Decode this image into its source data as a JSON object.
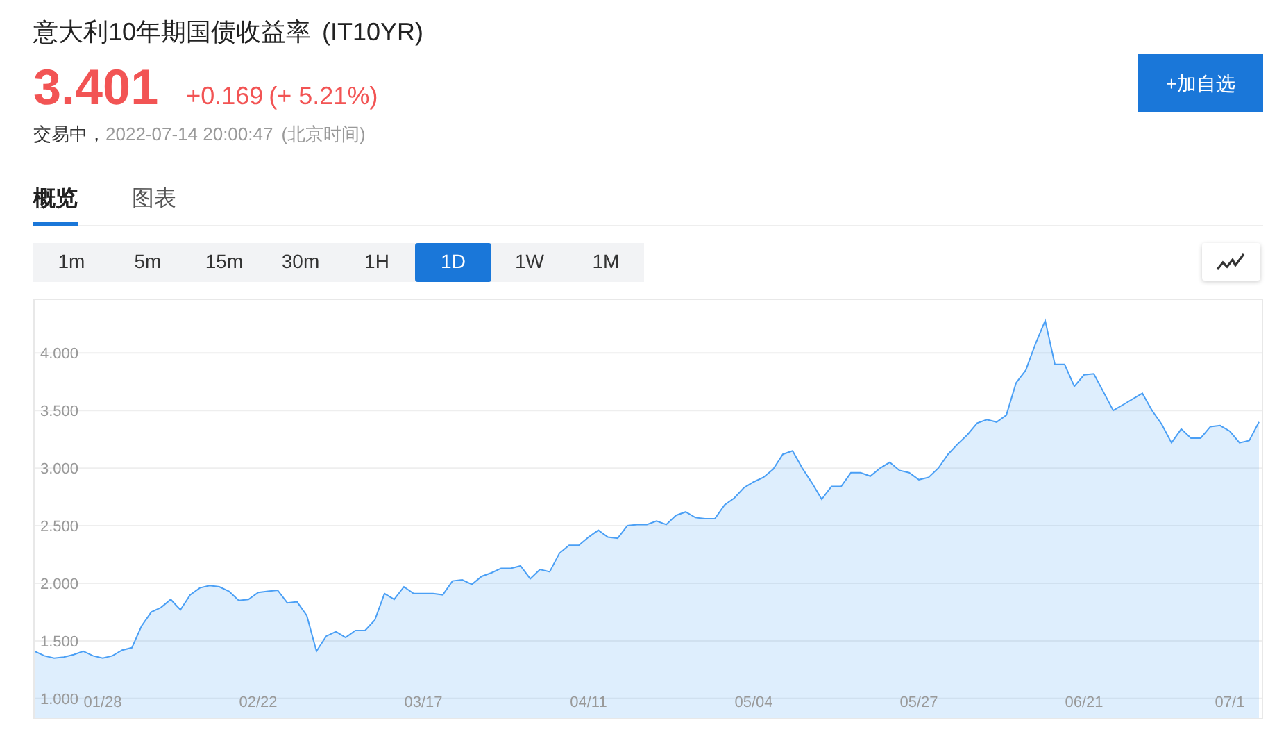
{
  "header": {
    "title": "意大利10年期国债收益率",
    "symbol": "(IT10YR)",
    "price": "3.401",
    "change": "+0.169",
    "change_pct": "(+ 5.21%)",
    "status": "交易中，",
    "timestamp": "2022-07-14 20:00:47",
    "timezone": "(北京时间)",
    "add_button": "+加自选"
  },
  "tabs": [
    {
      "label": "概览",
      "selected": true
    },
    {
      "label": "图表",
      "selected": false
    }
  ],
  "intervals": [
    {
      "label": "1m",
      "selected": false
    },
    {
      "label": "5m",
      "selected": false
    },
    {
      "label": "15m",
      "selected": false
    },
    {
      "label": "30m",
      "selected": false
    },
    {
      "label": "1H",
      "selected": false
    },
    {
      "label": "1D",
      "selected": true
    },
    {
      "label": "1W",
      "selected": false
    },
    {
      "label": "1M",
      "selected": false
    }
  ],
  "chart": {
    "chart_data": {
      "type": "area",
      "grid": true,
      "categories": [
        null,
        null,
        null,
        null,
        null,
        null,
        null,
        "01/28",
        null,
        null,
        null,
        null,
        null,
        null,
        null,
        null,
        null,
        null,
        null,
        null,
        null,
        null,
        null,
        "02/22",
        null,
        null,
        null,
        null,
        null,
        null,
        null,
        null,
        null,
        null,
        null,
        null,
        null,
        null,
        null,
        null,
        "03/17",
        null,
        null,
        null,
        null,
        null,
        null,
        null,
        null,
        null,
        null,
        null,
        null,
        null,
        null,
        null,
        null,
        "04/11",
        null,
        null,
        null,
        null,
        null,
        null,
        null,
        null,
        null,
        null,
        null,
        null,
        null,
        null,
        null,
        null,
        "05/04",
        null,
        null,
        null,
        null,
        null,
        null,
        null,
        null,
        null,
        null,
        null,
        null,
        null,
        null,
        null,
        null,
        "05/27",
        null,
        null,
        null,
        null,
        null,
        null,
        null,
        null,
        null,
        null,
        null,
        null,
        null,
        null,
        null,
        null,
        "06/21",
        null,
        null,
        null,
        null,
        null,
        null,
        null,
        null,
        null,
        null,
        null,
        null,
        null,
        null,
        "07/1",
        null,
        null,
        null
      ],
      "series": [
        {
          "color": "#4a9ff5",
          "values": [
            1.41,
            1.37,
            1.35,
            1.36,
            1.38,
            1.41,
            1.37,
            1.35,
            1.37,
            1.42,
            1.44,
            1.63,
            1.75,
            1.79,
            1.86,
            1.77,
            1.9,
            1.96,
            1.98,
            1.97,
            1.93,
            1.85,
            1.86,
            1.92,
            1.93,
            1.94,
            1.83,
            1.84,
            1.72,
            1.41,
            1.54,
            1.58,
            1.53,
            1.59,
            1.59,
            1.68,
            1.91,
            1.86,
            1.97,
            1.91,
            1.91,
            1.91,
            1.9,
            2.02,
            2.03,
            1.99,
            2.06,
            2.09,
            2.13,
            2.13,
            2.15,
            2.04,
            2.12,
            2.1,
            2.26,
            2.33,
            2.33,
            2.4,
            2.46,
            2.4,
            2.39,
            2.5,
            2.51,
            2.51,
            2.54,
            2.51,
            2.59,
            2.62,
            2.57,
            2.56,
            2.56,
            2.68,
            2.74,
            2.83,
            2.88,
            2.92,
            2.99,
            3.12,
            3.15,
            3,
            2.87,
            2.73,
            2.84,
            2.84,
            2.96,
            2.96,
            2.93,
            3,
            3.05,
            2.98,
            2.96,
            2.9,
            2.92,
            3,
            3.12,
            3.21,
            3.29,
            3.39,
            3.42,
            3.4,
            3.46,
            3.74,
            3.85,
            4.08,
            4.28,
            3.9,
            3.9,
            3.71,
            3.81,
            3.82,
            3.66,
            3.5,
            3.55,
            3.6,
            3.65,
            3.5,
            3.38,
            3.22,
            3.34,
            3.26,
            3.26,
            3.36,
            3.37,
            3.32,
            3.22,
            3.24,
            3.4
          ]
        }
      ],
      "ylim": [
        0.83,
        4.46
      ],
      "yticks": [
        {
          "value": 1,
          "label": "1.000"
        },
        {
          "value": 1.5,
          "label": "1.500"
        },
        {
          "value": 2,
          "label": "2.000"
        },
        {
          "value": 2.5,
          "label": "2.500"
        },
        {
          "value": 3,
          "label": "3.000"
        },
        {
          "value": 3.5,
          "label": "3.500"
        },
        {
          "value": 4,
          "label": "4.000"
        }
      ]
    }
  }
}
